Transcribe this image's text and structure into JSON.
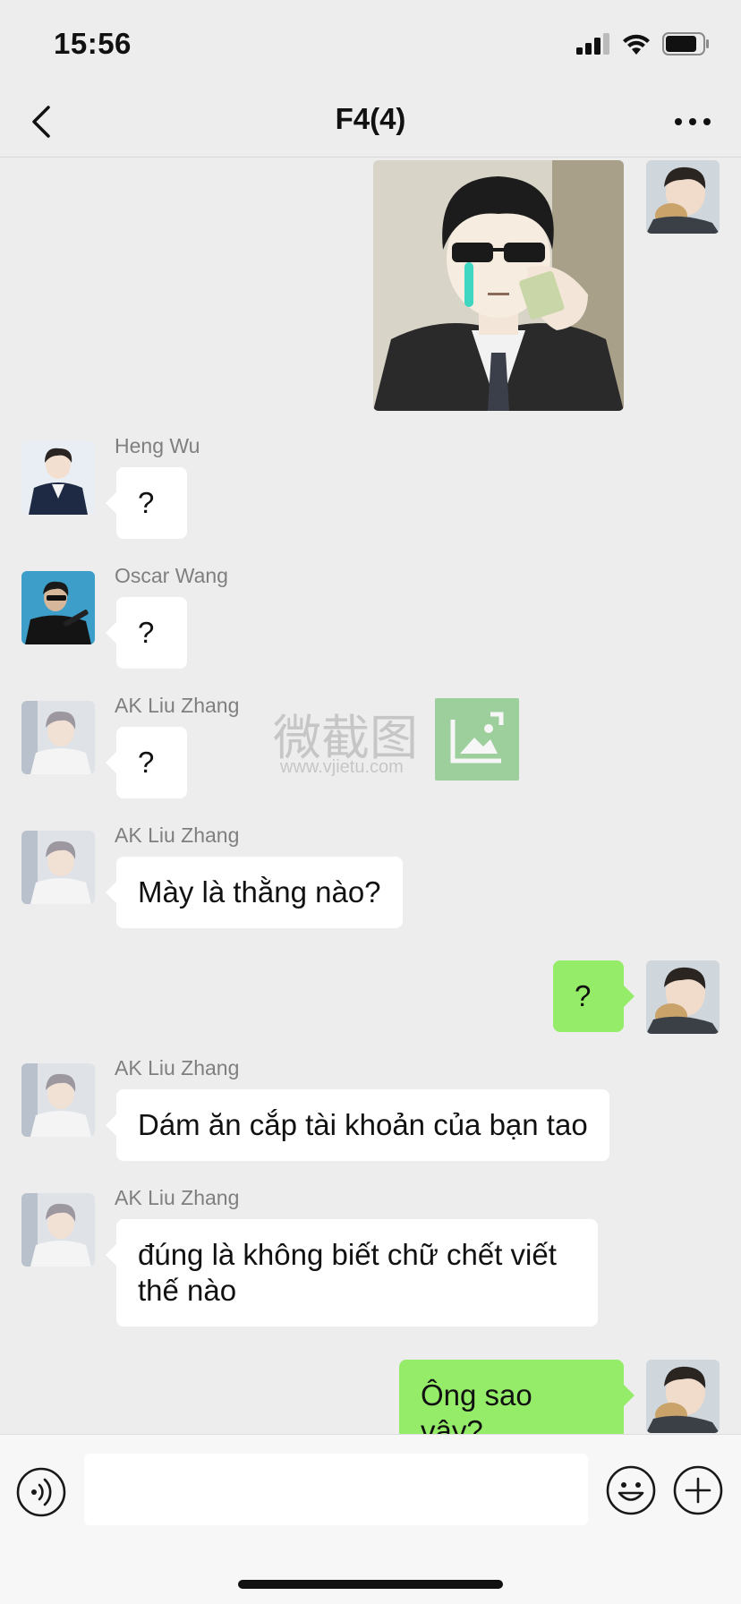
{
  "status_bar": {
    "time": "15:56"
  },
  "header": {
    "title": "F4(4)"
  },
  "messages": [
    {
      "side": "right",
      "type": "sticker",
      "sender": ""
    },
    {
      "side": "left",
      "sender": "Heng Wu",
      "text": "?"
    },
    {
      "side": "left",
      "sender": "Oscar Wang",
      "text": "?"
    },
    {
      "side": "left",
      "sender": "AK Liu Zhang",
      "text": "?"
    },
    {
      "side": "left",
      "sender": "AK Liu Zhang",
      "text": "Mày là thằng nào?"
    },
    {
      "side": "right",
      "sender": "",
      "text": "?"
    },
    {
      "side": "left",
      "sender": "AK Liu Zhang",
      "text": "Dám ăn cắp tài khoản của bạn tao"
    },
    {
      "side": "left",
      "sender": "AK Liu Zhang",
      "text": "đúng là không biết chữ chết viết thế nào"
    },
    {
      "side": "right",
      "sender": "",
      "text": "Ông sao vậy?"
    }
  ],
  "watermark": {
    "logo_text": "微截图",
    "url": "www.vjietu.com"
  },
  "input": {
    "value": "",
    "placeholder": ""
  },
  "icons": {
    "back": "chevron-left-icon",
    "more": "more-dots-icon",
    "voice": "voice-icon",
    "emoji": "emoji-icon",
    "plus": "plus-icon"
  },
  "colors": {
    "background": "#ededed",
    "outgoing_bubble": "#95ec69",
    "incoming_bubble": "#ffffff",
    "watermark_green": "#5cb85c"
  }
}
